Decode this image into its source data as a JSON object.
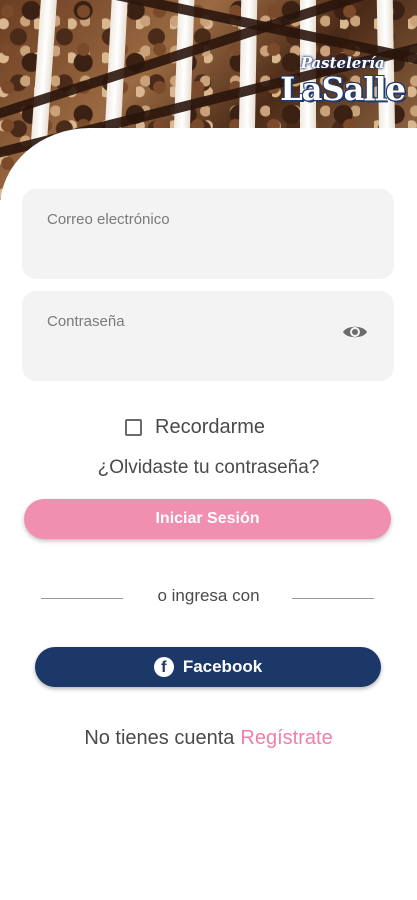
{
  "brand": {
    "line1": "Pastelería",
    "line2": "LaSalle"
  },
  "login": {
    "email_label": "Correo electrónico",
    "password_label": "Contraseña",
    "remember_label": "Recordarme",
    "forgot_label": "¿Olvidaste tu contraseña?",
    "submit_label": "Iniciar Sesión"
  },
  "divider": {
    "text": "o ingresa con"
  },
  "social": {
    "facebook_label": "Facebook",
    "facebook_glyph": "f"
  },
  "signup": {
    "prompt": "No tienes cuenta",
    "link": "Regístrate"
  },
  "colors": {
    "primary_pink": "#f08fb0",
    "facebook_blue": "#1b3868",
    "link_pink": "#ef7fa7"
  },
  "icons": {
    "password_toggle": "eye-icon",
    "facebook": "facebook-icon",
    "remember": "checkbox-icon"
  }
}
